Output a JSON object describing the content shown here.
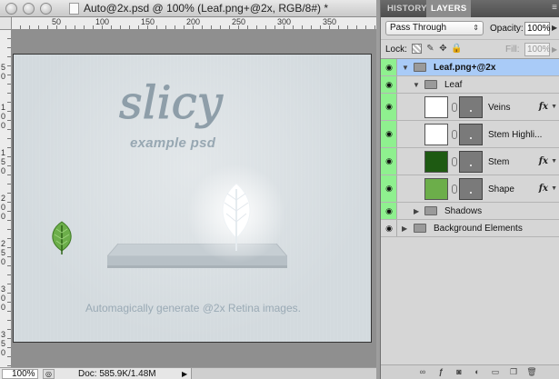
{
  "document": {
    "title": "Auto@2x.psd @ 100% (Leaf.png+@2x, RGB/8#) *",
    "ruler_top_labels": [
      "50",
      "100",
      "150",
      "200",
      "250",
      "300",
      "350"
    ],
    "ruler_left_labels": [
      "5\n0",
      "1\n0\n0",
      "1\n5\n0",
      "2\n0\n0",
      "2\n5\n0",
      "3\n0\n0",
      "3\n5\n0"
    ],
    "canvas": {
      "logo_text": "slicy",
      "subtitle": "example psd",
      "tagline": "Automagically generate @2x Retina images."
    },
    "status": {
      "zoom": "100%",
      "doc_info": "Doc: 585.9K/1.48M"
    }
  },
  "panel": {
    "tabs": [
      "HISTORY",
      "LAYERS"
    ],
    "active_tab": "LAYERS",
    "blend_mode": "Pass Through",
    "opacity_label": "Opacity:",
    "opacity_value": "100%",
    "lock_label": "Lock:",
    "fill_label": "Fill:",
    "fill_value": "100%",
    "layers": [
      {
        "name": "Leaf.png+@2x",
        "kind": "group",
        "expanded": true,
        "selected": true,
        "visible": true
      },
      {
        "name": "Leaf",
        "kind": "group",
        "expanded": true,
        "visible": true
      },
      {
        "name": "Veins",
        "kind": "layer",
        "thumb_color": "#ffffff",
        "fx": "fx",
        "visible": true
      },
      {
        "name": "Stem Highli...",
        "kind": "layer",
        "thumb_color": "#ffffff",
        "fx": "",
        "visible": true
      },
      {
        "name": "Stem",
        "kind": "layer",
        "thumb_color": "#1e5a12",
        "fx": "fx",
        "visible": true
      },
      {
        "name": "Shape",
        "kind": "layer",
        "thumb_color": "#6cae4a",
        "fx": "fx",
        "visible": true
      },
      {
        "name": "Shadows",
        "kind": "group",
        "expanded": false,
        "visible": true
      },
      {
        "name": "Background Elements",
        "kind": "group",
        "expanded": false,
        "visible": true
      }
    ]
  },
  "colors": {
    "visibility_green": "#8ff08f",
    "selected_blue": "#a9cbf7",
    "canvas_bg": "#d3dade",
    "leaf_green": "#6cae4a"
  }
}
